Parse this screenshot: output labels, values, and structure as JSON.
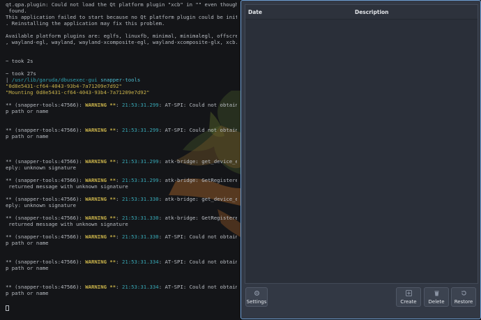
{
  "terminal": {
    "lines": [
      {
        "segs": [
          {
            "t": "qt.qpa.plugin: Could not load the Qt platform plugin \"xcb\" in \"\" even though it was",
            "c": ""
          }
        ]
      },
      {
        "segs": [
          {
            "t": " found.",
            "c": ""
          }
        ]
      },
      {
        "segs": [
          {
            "t": "This application failed to start because no Qt platform plugin could be initialized",
            "c": ""
          }
        ]
      },
      {
        "segs": [
          {
            "t": ". Reinstalling the application may fix this problem.",
            "c": ""
          }
        ]
      },
      {
        "segs": []
      },
      {
        "segs": [
          {
            "t": "Available platform plugins are: eglfs, linuxfb, minimal, minimalegl, offscreen, vnc",
            "c": ""
          }
        ]
      },
      {
        "segs": [
          {
            "t": ", wayland-egl, wayland, wayland-xcomposite-egl, wayland-xcomposite-glx, xcb.",
            "c": ""
          }
        ]
      },
      {
        "segs": []
      },
      {
        "segs": []
      },
      {
        "segs": [
          {
            "t": "~ took 2s",
            "c": ""
          }
        ]
      },
      {
        "segs": []
      },
      {
        "segs": [
          {
            "t": "~ took 27s",
            "c": ""
          }
        ]
      },
      {
        "segs": [
          {
            "t": "| ",
            "c": ""
          },
          {
            "t": "/usr/lib/garuda/dbusexec-gui",
            "c": "c-path"
          },
          {
            "t": " ",
            "c": ""
          },
          {
            "t": "snapper-tools",
            "c": "c-cmd"
          }
        ]
      },
      {
        "segs": [
          {
            "t": "\"0d8e5431-cf64-4043-93b4-7a71209e7d92\"",
            "c": "c-str"
          }
        ]
      },
      {
        "segs": [
          {
            "t": "\"Mounting 0d8e5431-cf64-4043-93b4-7a71209e7d92\"",
            "c": "c-str"
          }
        ]
      },
      {
        "segs": []
      },
      {
        "segs": [
          {
            "t": "** (snapper-tools:47566): ",
            "c": ""
          },
          {
            "t": "WARNING **",
            "c": "c-warn"
          },
          {
            "t": ": ",
            "c": ""
          },
          {
            "t": "21:53:31.299",
            "c": "c-time"
          },
          {
            "t": ": AT-SPI: Could not obtain deskto",
            "c": ""
          }
        ]
      },
      {
        "segs": [
          {
            "t": "p path or name",
            "c": ""
          }
        ]
      },
      {
        "segs": []
      },
      {
        "segs": []
      },
      {
        "segs": [
          {
            "t": "** (snapper-tools:47566): ",
            "c": ""
          },
          {
            "t": "WARNING **",
            "c": "c-warn"
          },
          {
            "t": ": ",
            "c": ""
          },
          {
            "t": "21:53:31.299",
            "c": "c-time"
          },
          {
            "t": ": AT-SPI: Could not obtain deskto",
            "c": ""
          }
        ]
      },
      {
        "segs": [
          {
            "t": "p path or name",
            "c": ""
          }
        ]
      },
      {
        "segs": []
      },
      {
        "segs": []
      },
      {
        "segs": []
      },
      {
        "segs": [
          {
            "t": "** (snapper-tools:47566): ",
            "c": ""
          },
          {
            "t": "WARNING **",
            "c": "c-warn"
          },
          {
            "t": ": ",
            "c": ""
          },
          {
            "t": "21:53:31.299",
            "c": "c-time"
          },
          {
            "t": ": atk-bridge: get_device_events_r",
            "c": ""
          }
        ]
      },
      {
        "segs": [
          {
            "t": "eply: unknown signature",
            "c": ""
          }
        ]
      },
      {
        "segs": []
      },
      {
        "segs": [
          {
            "t": "** (snapper-tools:47566): ",
            "c": ""
          },
          {
            "t": "WARNING **",
            "c": "c-warn"
          },
          {
            "t": ": ",
            "c": ""
          },
          {
            "t": "21:53:31.299",
            "c": "c-time"
          },
          {
            "t": ": atk-bridge: GetRegisteredEvents",
            "c": ""
          }
        ]
      },
      {
        "segs": [
          {
            "t": " returned message with unknown signature",
            "c": ""
          }
        ]
      },
      {
        "segs": []
      },
      {
        "segs": [
          {
            "t": "** (snapper-tools:47566): ",
            "c": ""
          },
          {
            "t": "WARNING **",
            "c": "c-warn"
          },
          {
            "t": ": ",
            "c": ""
          },
          {
            "t": "21:53:31.330",
            "c": "c-time"
          },
          {
            "t": ": atk-bridge: get_device_events_r",
            "c": ""
          }
        ]
      },
      {
        "segs": [
          {
            "t": "eply: unknown signature",
            "c": ""
          }
        ]
      },
      {
        "segs": []
      },
      {
        "segs": [
          {
            "t": "** (snapper-tools:47566): ",
            "c": ""
          },
          {
            "t": "WARNING **",
            "c": "c-warn"
          },
          {
            "t": ": ",
            "c": ""
          },
          {
            "t": "21:53:31.330",
            "c": "c-time"
          },
          {
            "t": ": atk-bridge: GetRegisteredEvents",
            "c": ""
          }
        ]
      },
      {
        "segs": [
          {
            "t": " returned message with unknown signature",
            "c": ""
          }
        ]
      },
      {
        "segs": []
      },
      {
        "segs": [
          {
            "t": "** (snapper-tools:47566): ",
            "c": ""
          },
          {
            "t": "WARNING **",
            "c": "c-warn"
          },
          {
            "t": ": ",
            "c": ""
          },
          {
            "t": "21:53:31.330",
            "c": "c-time"
          },
          {
            "t": ": AT-SPI: Could not obtain deskto",
            "c": ""
          }
        ]
      },
      {
        "segs": [
          {
            "t": "p path or name",
            "c": ""
          }
        ]
      },
      {
        "segs": []
      },
      {
        "segs": []
      },
      {
        "segs": [
          {
            "t": "** (snapper-tools:47566): ",
            "c": ""
          },
          {
            "t": "WARNING **",
            "c": "c-warn"
          },
          {
            "t": ": ",
            "c": ""
          },
          {
            "t": "21:53:31.334",
            "c": "c-time"
          },
          {
            "t": ": AT-SPI: Could not obtain deskto",
            "c": ""
          }
        ]
      },
      {
        "segs": [
          {
            "t": "p path or name",
            "c": ""
          }
        ]
      },
      {
        "segs": []
      },
      {
        "segs": []
      },
      {
        "segs": [
          {
            "t": "** (snapper-tools:47566): ",
            "c": ""
          },
          {
            "t": "WARNING **",
            "c": "c-warn"
          },
          {
            "t": ": ",
            "c": ""
          },
          {
            "t": "21:53:31.334",
            "c": "c-time"
          },
          {
            "t": ": AT-SPI: Could not obtain deskto",
            "c": ""
          }
        ]
      },
      {
        "segs": [
          {
            "t": "p path or name",
            "c": ""
          }
        ]
      }
    ]
  },
  "snapper": {
    "columns": {
      "date": "Date",
      "description": "Description"
    },
    "rows": [],
    "buttons": {
      "settings": {
        "label": "Settings",
        "icon": "gear-icon"
      },
      "create": {
        "label": "Create",
        "icon": "plus-icon"
      },
      "delete": {
        "label": "Delete",
        "icon": "trash-icon"
      },
      "restore": {
        "label": "Restore",
        "icon": "restore-icon"
      }
    }
  },
  "colors": {
    "terminal_bg": "#141518",
    "window_border": "#6e9fd4",
    "window_bg": "#323844",
    "warning": "#c9b24a",
    "timestamp": "#38a8b6"
  }
}
